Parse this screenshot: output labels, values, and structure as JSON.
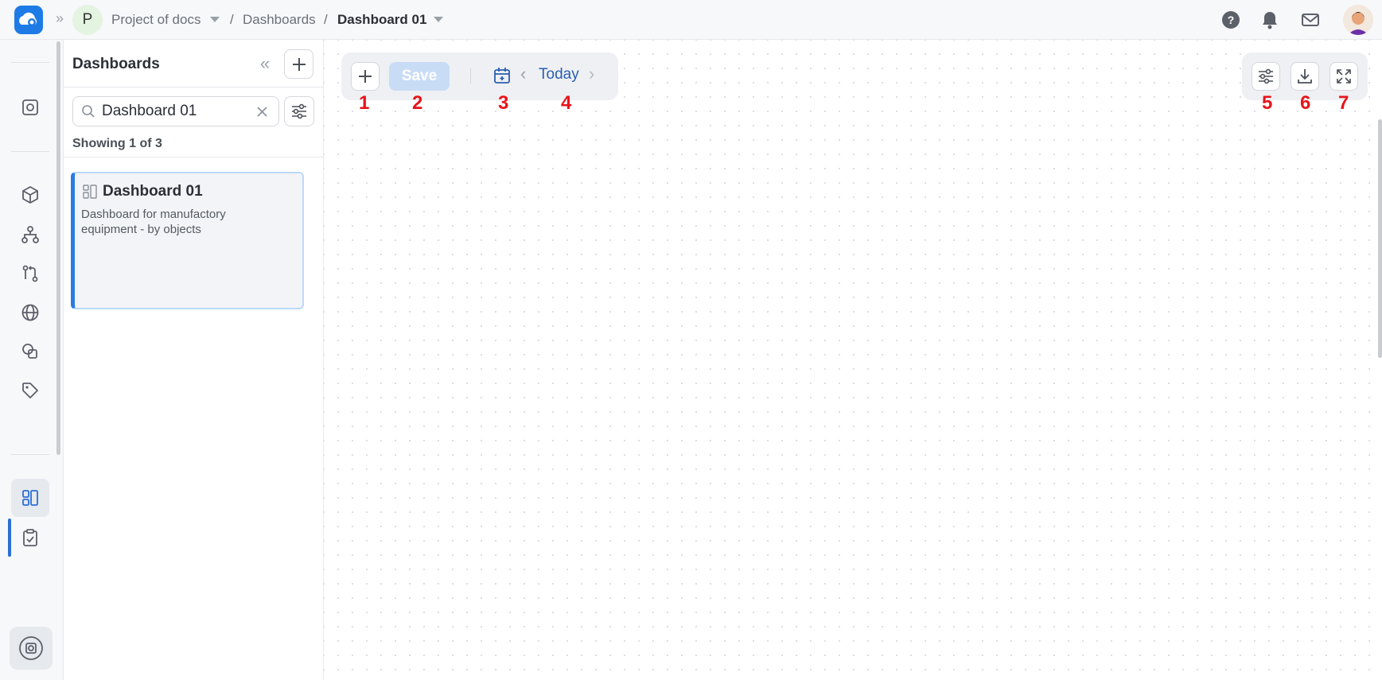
{
  "breadcrumb": {
    "project_initial": "P",
    "project": "Project of docs",
    "section": "Dashboards",
    "current": "Dashboard 01",
    "separator": "/"
  },
  "panel": {
    "title": "Dashboards",
    "search_value": "Dashboard 01",
    "showing": "Showing 1 of 3",
    "items": [
      {
        "title": "Dashboard 01",
        "description": "Dashboard for manufactory equipment - by objects"
      }
    ]
  },
  "toolbar": {
    "save_label": "Save",
    "date_label": "Today"
  },
  "annotations": [
    "1",
    "2",
    "3",
    "4",
    "5",
    "6",
    "7"
  ],
  "icons": {
    "logo": "cloud-logo-icon",
    "help": "help-icon",
    "notifications": "bell-icon",
    "mail": "mail-icon",
    "rail": [
      "square-circle-icon",
      "cube-icon",
      "hierarchy-icon",
      "git-compare-icon",
      "globe-icon",
      "shapes-icon",
      "tag-icon",
      "dashboard-icon",
      "clipboard-check-icon"
    ]
  },
  "colors": {
    "accent": "#2a7be4",
    "annotation": "#e8141a",
    "save_disabled": "#c9dcf6"
  }
}
